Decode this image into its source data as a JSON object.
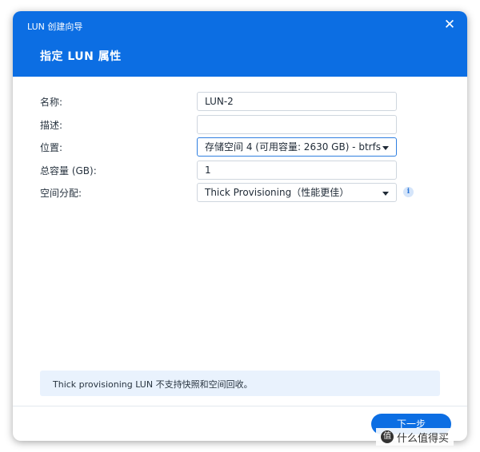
{
  "dialog": {
    "wizard_title": "LUN 创建向导",
    "close_icon": "close-icon",
    "step_title": "指定 LUN 属性"
  },
  "form": {
    "name": {
      "label": "名称:",
      "value": "LUN-2"
    },
    "description": {
      "label": "描述:",
      "value": ""
    },
    "location": {
      "label": "位置:",
      "value": "存储空间 4 (可用容量: 2630 GB) - btrfs"
    },
    "capacity": {
      "label": "总容量 (GB):",
      "value": "1"
    },
    "allocation": {
      "label": "空间分配:",
      "value": "Thick Provisioning（性能更佳）",
      "info_icon": "info-icon"
    }
  },
  "notice": "Thick provisioning LUN 不支持快照和空间回收。",
  "footer": {
    "next_label": "下一步"
  },
  "watermark": {
    "text": "值 什么值得买"
  },
  "colors": {
    "accent": "#0c6ee3",
    "notice_bg": "#e9f2fd"
  }
}
